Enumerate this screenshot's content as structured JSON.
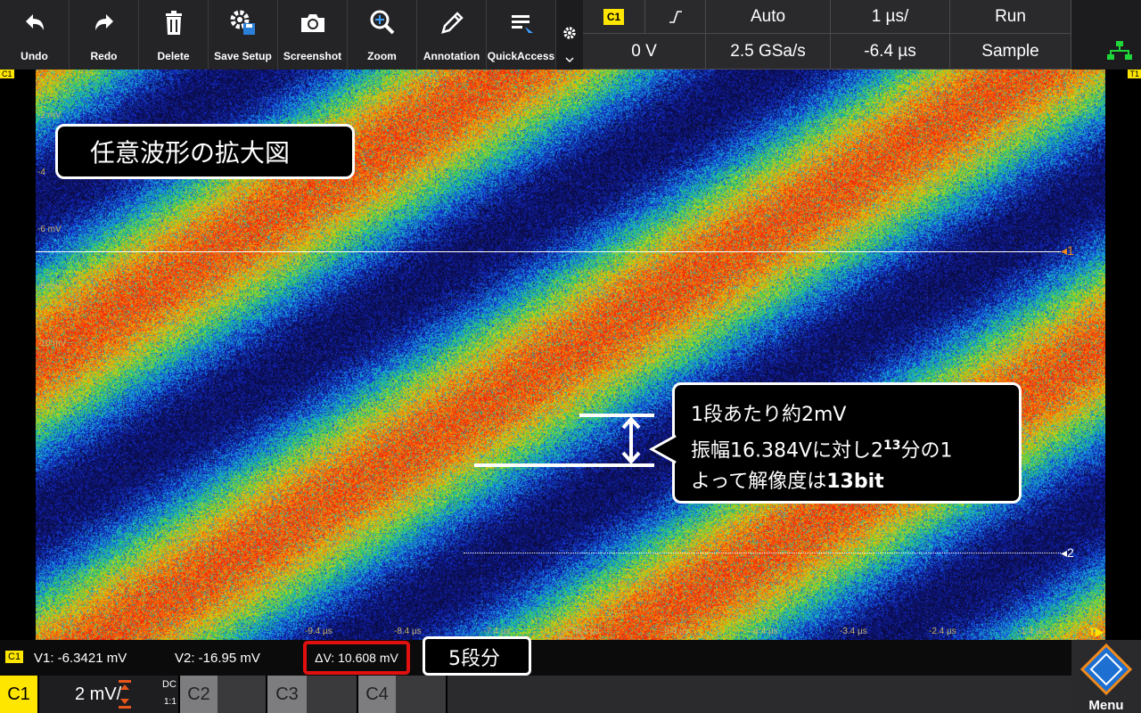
{
  "toolbar": {
    "undo": "Undo",
    "redo": "Redo",
    "delete": "Delete",
    "save_setup": "Save Setup",
    "screenshot": "Screenshot",
    "zoom": "Zoom",
    "annotation": "Annotation",
    "quick_access": "QuickAccess"
  },
  "acquisition": {
    "source": "C1",
    "slope_symbol": "⎍",
    "trigger_mode": "Auto",
    "timebase": "1 µs/",
    "run_state": "Run",
    "trigger_level": "0 V",
    "sample_rate": "2.5 GSa/s",
    "horizontal_position": "-6.4 µs",
    "acquire_mode": "Sample"
  },
  "screen": {
    "y_labels": [
      "-2 mV",
      "-4",
      "-6 mV",
      "-8 mV",
      "-10 mV"
    ],
    "x_labels": [
      "-9.4 µs",
      "-8.4 µs",
      "-7.4 µs",
      "-6.4 µs",
      "-5.4 µs",
      "-4.4 µs",
      "-3.4 µs",
      "-2.4 µs",
      "-1.4 µs"
    ],
    "cursor1_label": "1",
    "cursor2_label": "2",
    "c1_corner": "C1",
    "trigger_marker": "T▶",
    "t_corner": "T1"
  },
  "callouts": {
    "title": "任意波形の拡大図",
    "line1": "1段あたり約2mV",
    "line2_prefix": "振幅16.384Vに対し2",
    "line2_sup": "13",
    "line2_suffix": "分の1",
    "line3_prefix": "よって解像度は",
    "line3_bold": "13bit",
    "steps": "5段分"
  },
  "status": {
    "channel": "C1",
    "v1": "V1: -6.3421 mV",
    "v2": "V2: -16.95 mV",
    "dv": "ΔV: 10.608 mV"
  },
  "bottom": {
    "c1": "C1",
    "scale": "2 mV/",
    "coupling": "DC",
    "ratio": "1:1",
    "c2": "C2",
    "c3": "C3",
    "c4": "C4",
    "menu": "Menu"
  },
  "colors": {
    "c1_yellow": "#ffe600",
    "highlight_red": "#e01010"
  }
}
